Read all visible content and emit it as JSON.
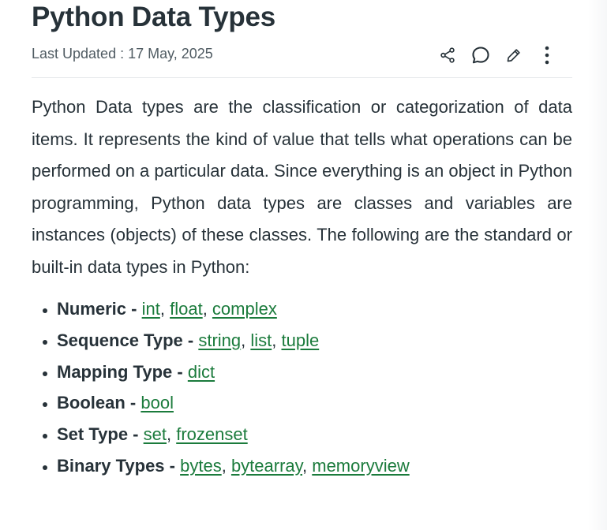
{
  "article": {
    "title": "Python Data Types",
    "last_updated": "Last Updated : 17 May, 2025",
    "intro": "Python Data types are the classification or categorization of data items. It represents the kind of value that tells what operations can be performed on a particular data. Since everything is an object in Python programming, Python data types are classes and variables are instances (objects) of these classes. The following are the standard or built-in data types in Python:"
  },
  "actions": {
    "icons": [
      "share-icon",
      "comment-icon",
      "edit-icon",
      "more-options-icon"
    ]
  },
  "types": [
    {
      "term": "Numeric",
      "links": [
        "int",
        "float",
        "complex"
      ]
    },
    {
      "term": "Sequence Type",
      "links": [
        "string",
        "list",
        "tuple"
      ]
    },
    {
      "term": "Mapping Type",
      "links": [
        "dict"
      ]
    },
    {
      "term": "Boolean",
      "links": [
        "bool"
      ]
    },
    {
      "term": "Set Type",
      "links": [
        "set",
        "frozenset"
      ]
    },
    {
      "term": "Binary Types",
      "links": [
        "bytes",
        "bytearray",
        "memoryview"
      ]
    }
  ],
  "colors": {
    "text": "#273239",
    "link": "#1b7b3c",
    "meta": "#4f5b62"
  }
}
